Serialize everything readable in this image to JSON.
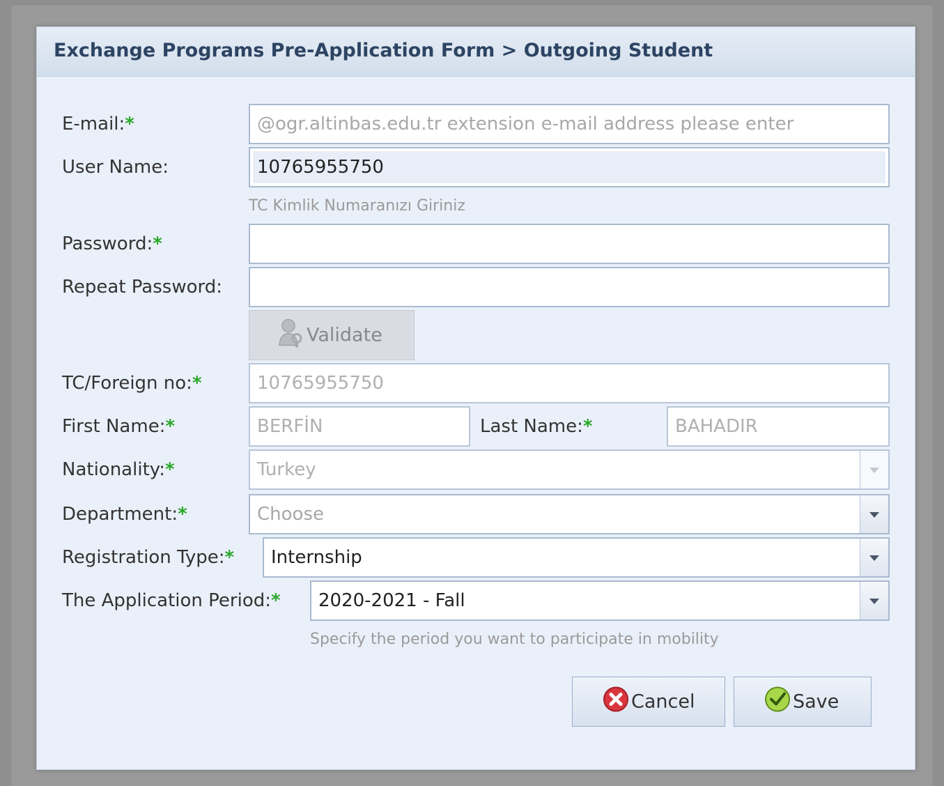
{
  "dialog": {
    "title": "Exchange Programs Pre-Application Form > Outgoing Student"
  },
  "form": {
    "required_marker": "*",
    "email": {
      "label": "E-mail:",
      "value": "",
      "placeholder": "@ogr.altinbas.edu.tr extension e-mail address please enter"
    },
    "username": {
      "label": "User Name:",
      "value": "10765955750",
      "hint": "TC Kimlik Numaranızı Giriniz"
    },
    "password": {
      "label": "Password:",
      "value": ""
    },
    "repeat_password": {
      "label": "Repeat Password:",
      "value": ""
    },
    "validate_button": {
      "label": "Validate",
      "icon": "user-key-icon",
      "enabled": false
    },
    "tc_foreign_no": {
      "label": "TC/Foreign no:",
      "value": "10765955750",
      "disabled": true
    },
    "first_name": {
      "label": "First Name:",
      "value": "BERFİN",
      "disabled": true
    },
    "last_name": {
      "label": "Last Name:",
      "value": "BAHADIR",
      "disabled": true
    },
    "nationality": {
      "label": "Nationality:",
      "value": "Turkey",
      "disabled": true
    },
    "department": {
      "label": "Department:",
      "value": "",
      "placeholder": "Choose"
    },
    "registration_type": {
      "label": "Registration Type:",
      "value": "Internship"
    },
    "application_period": {
      "label": "The Application Period:",
      "value": "2020-2021 - Fall",
      "hint": "Specify the period you want to participate in mobility"
    }
  },
  "buttons": {
    "cancel": {
      "label": "Cancel",
      "icon": "cancel-icon"
    },
    "save": {
      "label": "Save",
      "icon": "check-icon"
    }
  },
  "colors": {
    "required": "#2aa82a",
    "title_text": "#2d4463",
    "panel_bg": "#eaf0f9",
    "field_border": "#a9bad0"
  }
}
